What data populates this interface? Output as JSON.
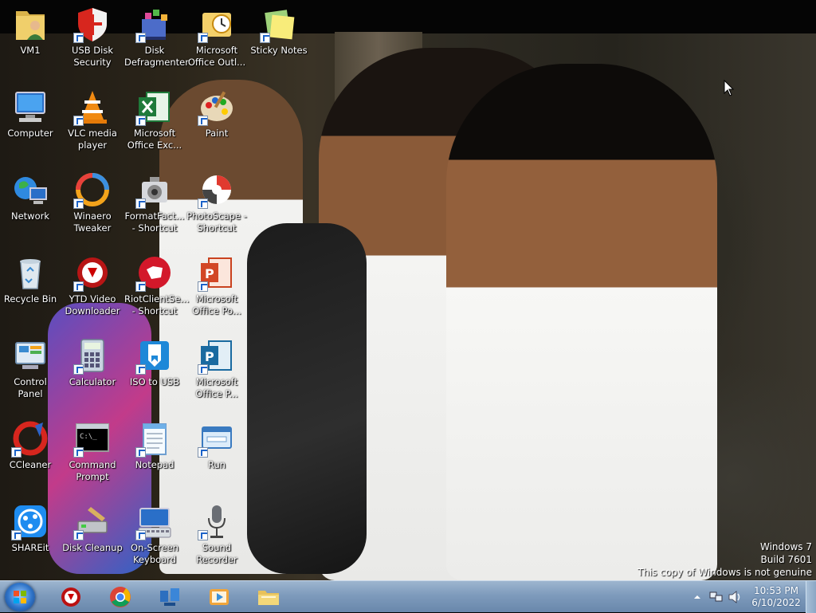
{
  "desktop": {
    "icons": [
      {
        "label": "VM1",
        "icon": "user-folder-icon",
        "shortcut": false
      },
      {
        "label": "USB Disk Security",
        "icon": "shield-icon",
        "shortcut": true
      },
      {
        "label": "Disk Defragmenter",
        "icon": "defragmenter-icon",
        "shortcut": true
      },
      {
        "label": "Microsoft Office Outl...",
        "icon": "outlook-icon",
        "shortcut": true
      },
      {
        "label": "Sticky Notes",
        "icon": "sticky-notes-icon",
        "shortcut": true
      },
      {
        "label": "Computer",
        "icon": "computer-icon",
        "shortcut": false
      },
      {
        "label": "VLC media player",
        "icon": "vlc-cone-icon",
        "shortcut": true
      },
      {
        "label": "Microsoft Office Exc...",
        "icon": "excel-icon",
        "shortcut": true
      },
      {
        "label": "Paint",
        "icon": "paint-palette-icon",
        "shortcut": true
      },
      {
        "label": "Network",
        "icon": "network-globe-icon",
        "shortcut": false
      },
      {
        "label": "Winaero Tweaker",
        "icon": "winaero-tweaker-icon",
        "shortcut": true
      },
      {
        "label": "FormatFact... - Shortcut",
        "icon": "format-factory-icon",
        "shortcut": true
      },
      {
        "label": "PhotoScape - Shortcut",
        "icon": "photoscape-icon",
        "shortcut": true
      },
      {
        "label": "Recycle Bin",
        "icon": "recycle-bin-icon",
        "shortcut": false
      },
      {
        "label": "YTD Video Downloader",
        "icon": "ytd-downloader-icon",
        "shortcut": true
      },
      {
        "label": "RiotClientSe... - Shortcut",
        "icon": "riot-client-icon",
        "shortcut": true
      },
      {
        "label": "Microsoft Office Po...",
        "icon": "powerpoint-icon",
        "shortcut": true
      },
      {
        "label": "Control Panel",
        "icon": "control-panel-icon",
        "shortcut": false
      },
      {
        "label": "Calculator",
        "icon": "calculator-icon",
        "shortcut": true
      },
      {
        "label": "ISO to USB",
        "icon": "iso-to-usb-icon",
        "shortcut": true
      },
      {
        "label": "Microsoft Office P...",
        "icon": "publisher-icon",
        "shortcut": true
      },
      {
        "label": "CCleaner",
        "icon": "ccleaner-icon",
        "shortcut": true
      },
      {
        "label": "Command Prompt",
        "icon": "command-prompt-icon",
        "shortcut": true
      },
      {
        "label": "Notepad",
        "icon": "notepad-icon",
        "shortcut": true
      },
      {
        "label": "Run",
        "icon": "run-icon",
        "shortcut": true
      },
      {
        "label": "SHAREit",
        "icon": "shareit-icon",
        "shortcut": true
      },
      {
        "label": "Disk Cleanup",
        "icon": "disk-cleanup-icon",
        "shortcut": true
      },
      {
        "label": "On-Screen Keyboard",
        "icon": "keyboard-icon",
        "shortcut": true
      },
      {
        "label": "Sound Recorder",
        "icon": "microphone-icon",
        "shortcut": true
      }
    ],
    "watermark": {
      "line1": "Windows 7",
      "line2": "Build 7601",
      "line3": "This copy of Windows is not genuine"
    }
  },
  "taskbar": {
    "start_icon": "windows-start-orb-icon",
    "pinned": [
      {
        "name": "ytd-downloader",
        "icon": "ytd-downloader-icon"
      },
      {
        "name": "chrome",
        "icon": "chrome-icon"
      },
      {
        "name": "network-app",
        "icon": "network-app-icon"
      },
      {
        "name": "media-player",
        "icon": "media-player-icon"
      },
      {
        "name": "file-explorer",
        "icon": "folder-icon"
      }
    ],
    "tray": {
      "time": "10:53 PM",
      "date": "6/10/2022"
    }
  },
  "colors": {
    "taskbar_top": "#9db5cf",
    "taskbar_bottom": "#6987ab",
    "label_text": "#ffffff"
  }
}
